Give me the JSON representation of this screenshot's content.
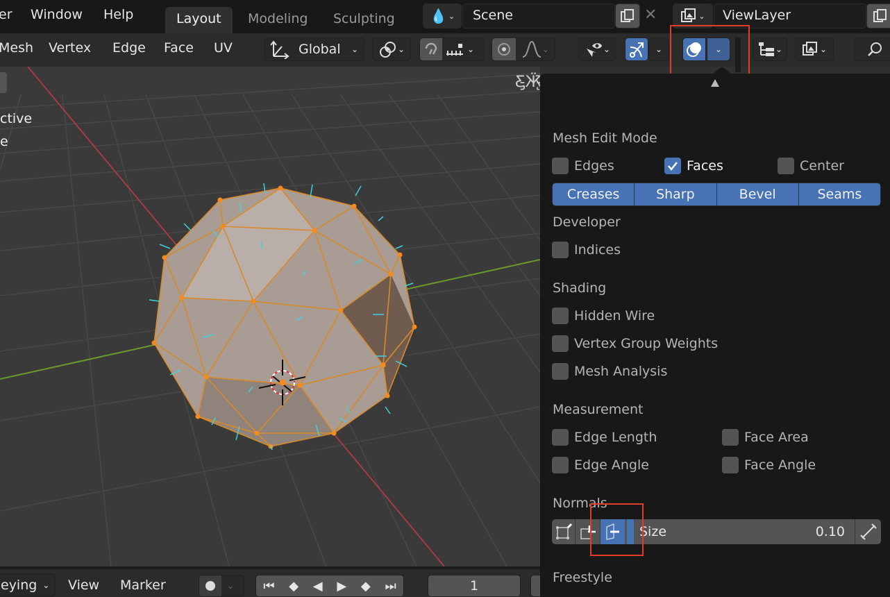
{
  "topbar": {
    "menus": [
      "er",
      "Window",
      "Help"
    ],
    "workspace_tabs": [
      {
        "label": "Layout",
        "active": true
      },
      {
        "label": "Modeling",
        "active": false
      },
      {
        "label": "Sculpting",
        "active": false
      }
    ],
    "scene": {
      "icon": "scene-icon",
      "value": "Scene"
    },
    "view_layer": {
      "icon": "render-layers-icon",
      "value": "ViewLayer"
    }
  },
  "header": {
    "menus": [
      "Mesh",
      "Vertex",
      "Edge",
      "Face",
      "UV"
    ],
    "transform_orientation": "Global",
    "icons": [
      "pivot-point-icon",
      "snap-magnet-icon",
      "snap-increment-icon",
      "proportional-edit-icon",
      "falloff-curve-icon",
      "selectability-icon",
      "gizmo-icon",
      "overlays-icon",
      "outliner-display-icon",
      "display-filter-icon",
      "search-icon"
    ]
  },
  "viewport": {
    "overlay_text": [
      "ctive",
      "e"
    ]
  },
  "timeline": {
    "keying_label": "eying",
    "view_label": "View",
    "marker_label": "Marker",
    "current_frame": "1"
  },
  "overlay_popover": {
    "sections": {
      "mesh_edit_mode": "Mesh Edit Mode",
      "developer": "Developer",
      "shading": "Shading",
      "measurement": "Measurement",
      "normals": "Normals",
      "freestyle": "Freestyle"
    },
    "mesh_edit_checkboxes": [
      {
        "label": "Edges",
        "checked": false
      },
      {
        "label": "Faces",
        "checked": true
      },
      {
        "label": "Center",
        "checked": false
      }
    ],
    "edge_marks": [
      "Creases",
      "Sharp",
      "Bevel",
      "Seams"
    ],
    "developer_checkboxes": [
      {
        "label": "Indices",
        "checked": false
      }
    ],
    "shading_checkboxes": [
      {
        "label": "Hidden Wire",
        "checked": false
      },
      {
        "label": "Vertex Group Weights",
        "checked": false
      },
      {
        "label": "Mesh Analysis",
        "checked": false
      }
    ],
    "measurement_checkboxes": [
      {
        "label": "Edge Length",
        "checked": false
      },
      {
        "label": "Face Area",
        "checked": false
      },
      {
        "label": "Edge Angle",
        "checked": false
      },
      {
        "label": "Face Angle",
        "checked": false
      }
    ],
    "normals": {
      "buttons": [
        "vertex-normals-icon",
        "split-normals-icon",
        "face-normals-icon"
      ],
      "active_button": "face-normals-icon",
      "size_label": "Size",
      "size_value": "0.10"
    }
  },
  "colors": {
    "accent": "#4772b3",
    "highlight_box": "#e33a2a",
    "selection_orange": "#f58a1f",
    "normal_cyan": "#3fd2e0"
  }
}
